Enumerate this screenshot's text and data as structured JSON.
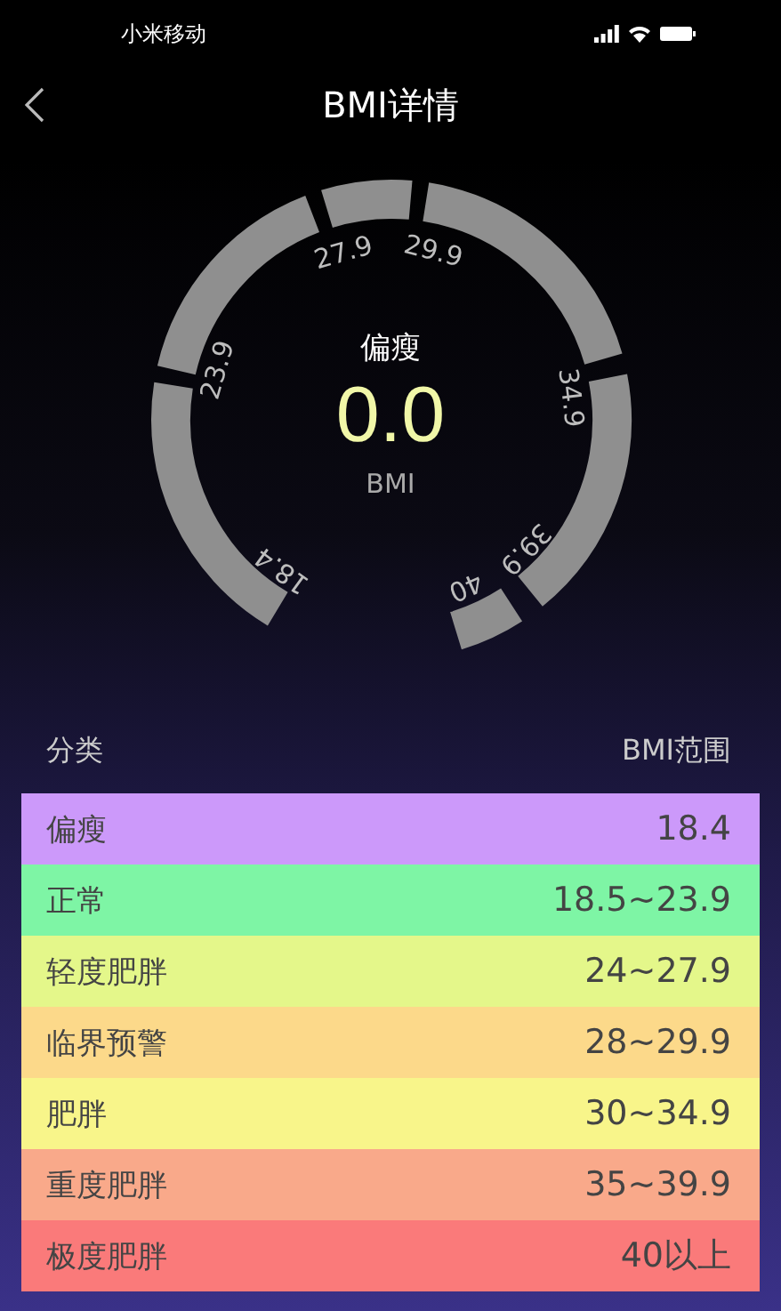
{
  "status_bar": {
    "carrier": "小米移动"
  },
  "nav": {
    "title": "BMI详情"
  },
  "gauge": {
    "category": "偏瘦",
    "value": "0.0",
    "unit": "BMI",
    "ticks": [
      "18.4",
      "23.9",
      "27.9",
      "29.9",
      "34.9",
      "39.9",
      "40"
    ]
  },
  "table": {
    "columns": [
      "分类",
      "BMI范围"
    ],
    "rows": [
      {
        "category": "偏瘦",
        "range": "18.4",
        "color": "#cc99fa"
      },
      {
        "category": "正常",
        "range": "18.5~23.9",
        "color": "#7ef5a5"
      },
      {
        "category": "轻度肥胖",
        "range": "24~27.9",
        "color": "#e4f78a"
      },
      {
        "category": "临界预警",
        "range": "28~29.9",
        "color": "#fcd98a"
      },
      {
        "category": "肥胖",
        "range": "30~34.9",
        "color": "#f8f58a"
      },
      {
        "category": "重度肥胖",
        "range": "35~39.9",
        "color": "#f9a98a"
      },
      {
        "category": "极度肥胖",
        "range": "40以上",
        "color": "#fa7a7a"
      }
    ]
  }
}
